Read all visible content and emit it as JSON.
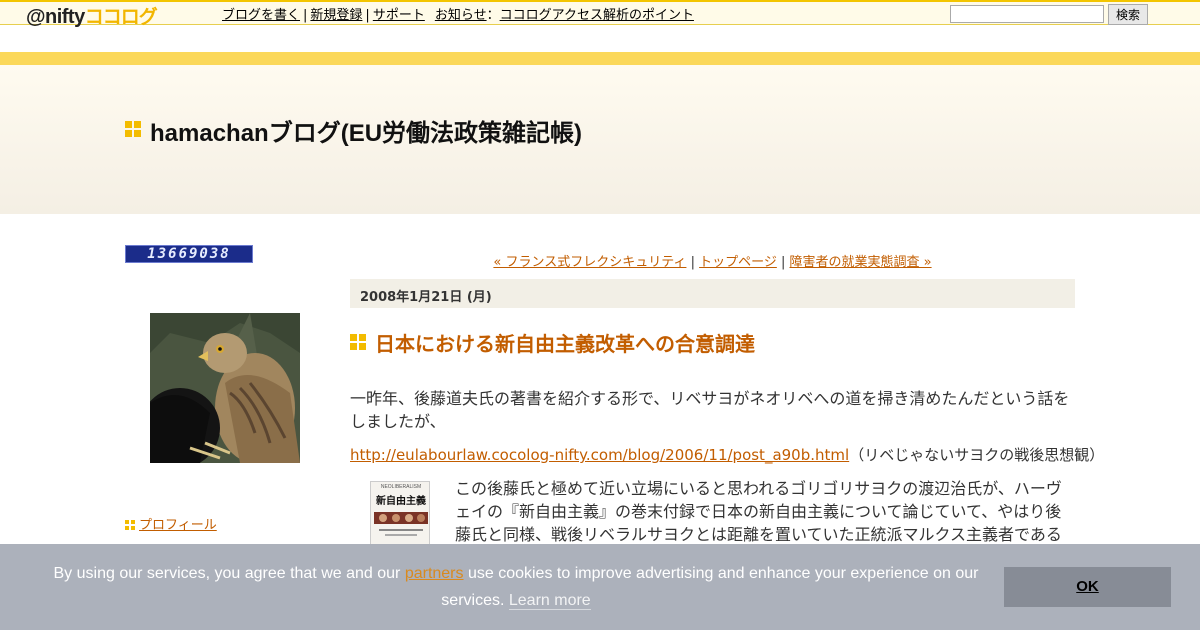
{
  "topbar": {
    "logo_prefix": "@nifty",
    "logo_brand": "ココログ",
    "nav": {
      "write": "ブログを書く",
      "register": "新規登録",
      "support": "サポート",
      "notice_label": "お知らせ",
      "notice_colon": "：",
      "notice_link": "ココログアクセス解析のポイント"
    },
    "search_value": "",
    "search_button": "検索"
  },
  "blog": {
    "title": "hamachanブログ(EU労働法政策雑記帳)"
  },
  "sidebar": {
    "counter": "13669038",
    "profile_link": "プロフィール"
  },
  "entry": {
    "nav": {
      "prev": "« フランス式フレクシキュリティ",
      "sep1": " | ",
      "top": "トップページ",
      "sep2": " | ",
      "next": "障害者の就業実態調査 »"
    },
    "date": "2008年1月21日 (月)",
    "title": "日本における新自由主義改革への合意調達",
    "para1": "一昨年、後藤道夫氏の著書を紹介する形で、リベサヨがネオリベへの道を掃き清めたんだという話をしましたが、",
    "link_url": "http://eulabourlaw.cocolog-nifty.com/blog/2006/11/post_a90b.html",
    "link_note": "（リベじゃないサヨクの戦後思想観）",
    "book_text": {
      "top": "NEOLIBERALISM",
      "title": "新自由主義"
    },
    "para2": "この後藤氏と極めて近い立場にいると思われるゴリゴリサヨクの渡辺治氏が、ハーヴェイの『新自由主義』の巻末付録で日本の新自由主義について論じていて、やはり後藤氏と同様、戦後リベラルサヨクとは距離を置いていた正統派マルクス主義者である"
  },
  "cookie": {
    "text_before": "By using our services, you agree that we and our ",
    "partners": "partners",
    "text_after": " use cookies to improve advertising and enhance your experience on our services. ",
    "learn_more": "Learn more",
    "ok": "OK"
  },
  "colors": {
    "accent": "#f3bc00",
    "link": "#c25d00",
    "cookie_bg": "#a9aeb9"
  }
}
